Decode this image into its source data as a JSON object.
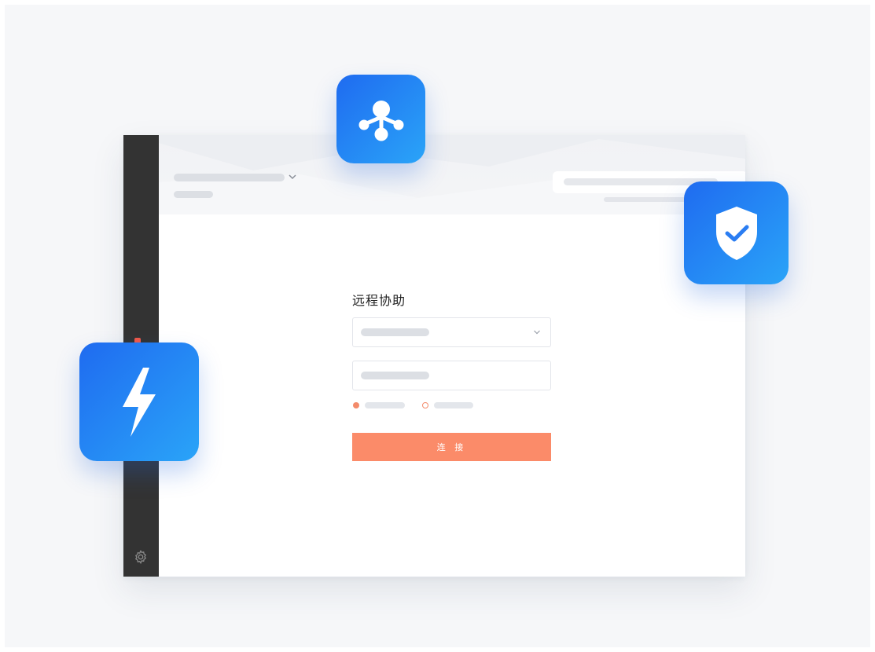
{
  "form": {
    "title": "远程协助",
    "connect_label": "连 接"
  },
  "colors": {
    "accent": "#fb8b69",
    "tile_gradient_start": "#1f6bf0",
    "tile_gradient_end": "#2aa4f8",
    "sidebar": "#333333"
  },
  "icons": {
    "network": "network-nodes-icon",
    "shield": "shield-check-icon",
    "bolt": "lightning-bolt-icon",
    "settings": "gear-icon",
    "chevron": "chevron-down-icon"
  },
  "options": {
    "selected_radio": 0
  }
}
